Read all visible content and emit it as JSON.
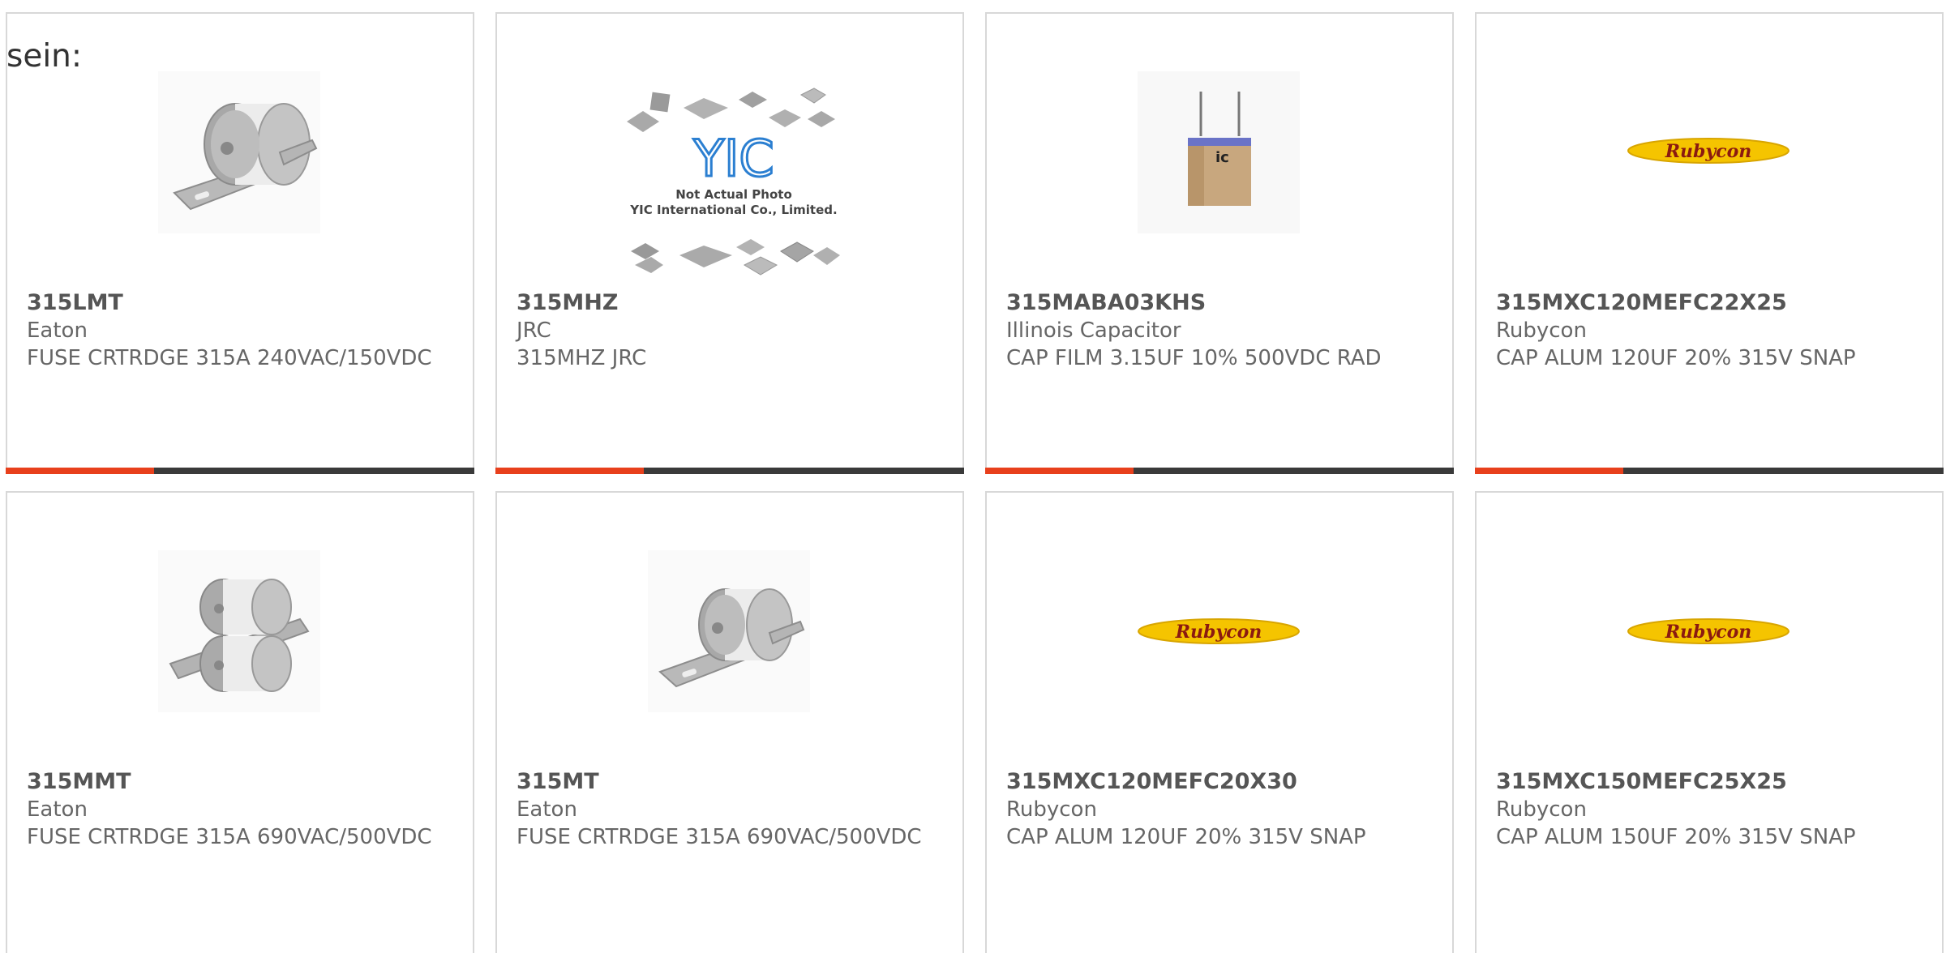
{
  "heading": "sein:",
  "products": [
    {
      "part": "315LMT",
      "mfr": "Eaton",
      "desc": "FUSE CRTRDGE 315A 240VAC/150VDC",
      "image": "fuse-single-icon"
    },
    {
      "part": "315MHZ",
      "mfr": "JRC",
      "desc": "315MHZ JRC",
      "image": "not-actual-photo-icon",
      "image_text": {
        "logo": "YIC",
        "line1": "Not Actual Photo",
        "line2": "YIC International Co., Limited."
      }
    },
    {
      "part": "315MABA03KHS",
      "mfr": "Illinois Capacitor",
      "desc": "CAP FILM 3.15UF 10% 500VDC RAD",
      "image": "film-capacitor-icon",
      "image_text": {
        "mark": "ic"
      }
    },
    {
      "part": "315MXC120MEFC22X25",
      "mfr": "Rubycon",
      "desc": "CAP ALUM 120UF 20% 315V SNAP",
      "image": "rubycon-logo",
      "image_text": {
        "logo": "Rubycon"
      }
    },
    {
      "part": "315MMT",
      "mfr": "Eaton",
      "desc": "FUSE CRTRDGE 315A 690VAC/500VDC",
      "image": "fuse-double-icon"
    },
    {
      "part": "315MT",
      "mfr": "Eaton",
      "desc": "FUSE CRTRDGE 315A 690VAC/500VDC",
      "image": "fuse-single-icon"
    },
    {
      "part": "315MXC120MEFC20X30",
      "mfr": "Rubycon",
      "desc": "CAP ALUM 120UF 20% 315V SNAP",
      "image": "rubycon-logo",
      "image_text": {
        "logo": "Rubycon"
      }
    },
    {
      "part": "315MXC150MEFC25X25",
      "mfr": "Rubycon",
      "desc": "CAP ALUM 150UF 20% 315V SNAP",
      "image": "rubycon-logo",
      "image_text": {
        "logo": "Rubycon"
      }
    }
  ],
  "colors": {
    "accent": "#e8401c",
    "bar": "#3a3a3a",
    "border": "#d8d8d8",
    "rubycon_yellow": "#f5c400",
    "rubycon_text": "#8b1a10"
  }
}
